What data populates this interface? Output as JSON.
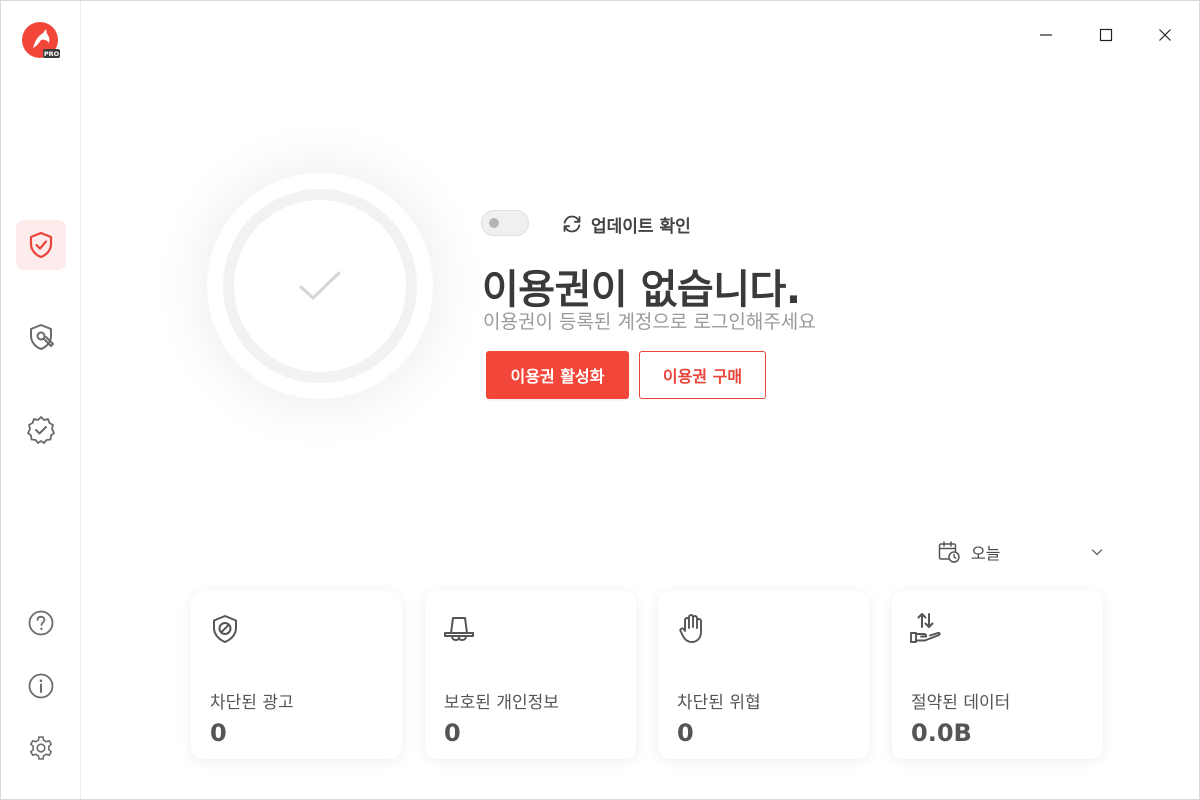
{
  "app": {
    "logo_badge": "PRO",
    "brand_color": "#f2463a"
  },
  "sidebar": {
    "items": [
      {
        "name": "protection",
        "icon": "shield-check-icon",
        "active": true
      },
      {
        "name": "tools",
        "icon": "shield-wrench-icon",
        "active": false
      },
      {
        "name": "verified",
        "icon": "badge-check-icon",
        "active": false
      }
    ],
    "bottom": [
      {
        "name": "help",
        "icon": "question-circle-icon"
      },
      {
        "name": "info",
        "icon": "info-circle-icon"
      },
      {
        "name": "settings",
        "icon": "gear-icon"
      }
    ]
  },
  "status": {
    "toggle_on": false,
    "update_label": "업데이트 확인",
    "title": "이용권이 없습니다.",
    "subtitle": "이용권이 등록된 계정으로 로그인해주세요",
    "activate_label": "이용권 활성화",
    "buy_label": "이용권 구매"
  },
  "period": {
    "selected": "오늘"
  },
  "stats": [
    {
      "icon": "shield-block-icon",
      "label": "차단된 광고",
      "value": "0"
    },
    {
      "icon": "bell-privacy-icon",
      "label": "보호된 개인정보",
      "value": "0"
    },
    {
      "icon": "hand-stop-icon",
      "label": "차단된 위협",
      "value": "0"
    },
    {
      "icon": "data-save-icon",
      "label": "절약된 데이터",
      "value": "0.0B"
    }
  ]
}
